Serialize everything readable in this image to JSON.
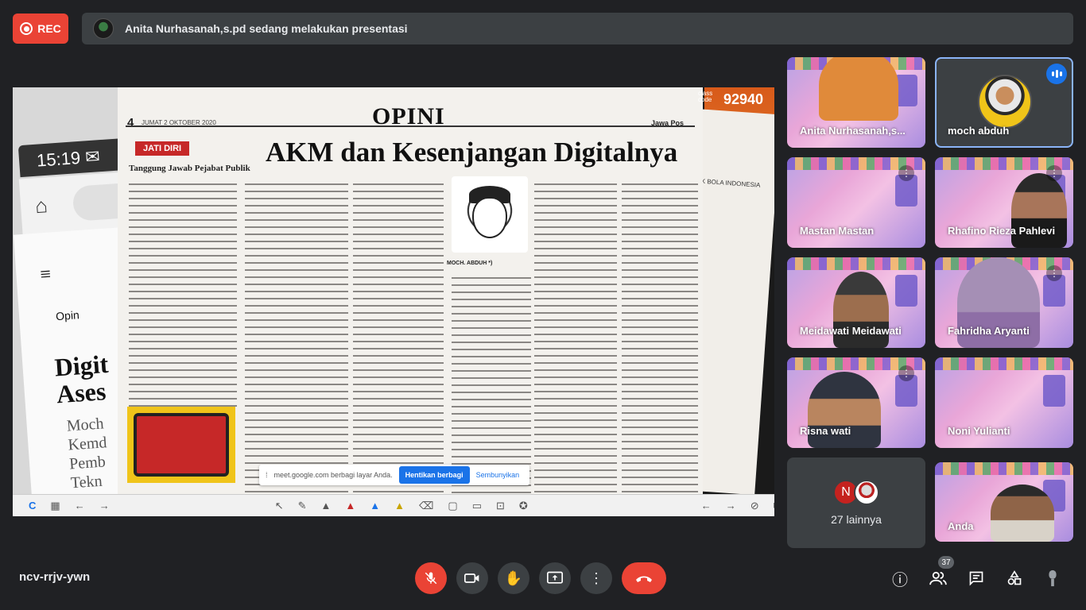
{
  "top": {
    "rec_label": "REC",
    "presenter_banner": "Anita Nurhasanah,s.pd sedang melakukan presentasi"
  },
  "presentation": {
    "phone_time": "15:19",
    "phone_texts": [
      "Opin",
      "Digit",
      "Ases",
      "Moch",
      "Kemd",
      "Pemb",
      "Tekn"
    ],
    "newspaper": {
      "page_number": "4",
      "date": "JUMAT 2 OKTOBER 2020",
      "publisher": "Jawa Pos",
      "section": "OPINI",
      "headline": "AKM dan Kesenjangan Digitalnya",
      "tag": "JATI DIRI",
      "subheadline": "Tanggung Jawab Pejabat Publik",
      "byline": "MOCH. ABDUH *)"
    },
    "back_paper_text": "AK BOLA INDONESIA",
    "class_code": {
      "label": "class code",
      "value": "92940"
    },
    "share_bar": {
      "message": "meet.google.com berbagi layar Anda.",
      "stop_label": "Hentikan berbagi",
      "hide_label": "Sembunyikan"
    }
  },
  "participants": [
    {
      "name": "Anita Nurhasanah,s...",
      "style": "banner"
    },
    {
      "name": "moch abduh",
      "style": "avatar",
      "speaking": true
    },
    {
      "name": "Mastan Mastan",
      "style": "banner"
    },
    {
      "name": "Rhafino Rieza Pahlevi",
      "style": "camera"
    },
    {
      "name": "Meidawati Meidawati",
      "style": "camera"
    },
    {
      "name": "Fahridha Aryanti",
      "style": "camera"
    },
    {
      "name": "Risna wati",
      "style": "camera"
    },
    {
      "name": "Noni Yulianti",
      "style": "banner"
    },
    {
      "name": "27 lainnya",
      "style": "others",
      "initial": "N"
    },
    {
      "name": "Anda",
      "style": "camera"
    }
  ],
  "bottom": {
    "meeting_code": "ncv-rrjv-ywn",
    "participant_count": "37"
  },
  "colors": {
    "accent_red": "#ea4335",
    "accent_blue": "#1a73e8",
    "background": "#202124"
  }
}
